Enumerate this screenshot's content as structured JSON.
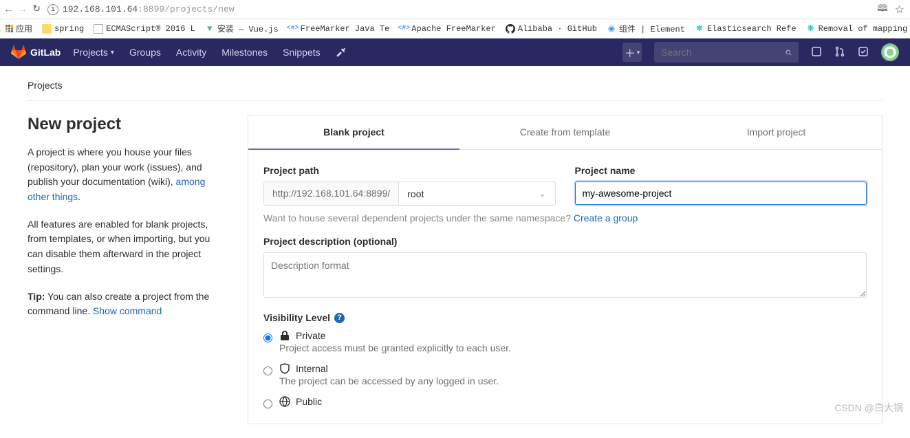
{
  "browser": {
    "url_host": "192.168.101.64",
    "url_port": ":8899",
    "url_path": "/projects/new",
    "translate_icon": "⇄",
    "star": "☆"
  },
  "bookmarks": {
    "apps": "应用",
    "items": [
      "spring",
      "ECMAScript® 2016 L",
      "安装 — Vue.js",
      "FreeMarker Java Te",
      "Apache FreeMarker",
      "Alibaba · GitHub",
      "组件 | Element",
      "Elasticsearch Refe",
      "Removal of mapping"
    ]
  },
  "header": {
    "brand": "GitLab",
    "nav": [
      "Projects",
      "Groups",
      "Activity",
      "Milestones",
      "Snippets"
    ],
    "search_placeholder": "Search"
  },
  "breadcrumb": "Projects",
  "sidebar": {
    "title": "New project",
    "p1a": "A project is where you house your files (repository), plan your work (issues), and publish your documentation (wiki), ",
    "p1_link": "among other things",
    "p1b": ".",
    "p2": "All features are enabled for blank projects, from templates, or when importing, but you can disable them afterward in the project settings.",
    "tip_label": "Tip:",
    "tip_text": " You can also create a project from the command line. ",
    "tip_link": "Show command"
  },
  "tabs": [
    "Blank project",
    "Create from template",
    "Import project"
  ],
  "form": {
    "path_label": "Project path",
    "path_prefix": "http://192.168.101.64:8899/",
    "namespace": "root",
    "name_label": "Project name",
    "name_value": "my-awesome-project",
    "hint_text": "Want to house several dependent projects under the same namespace? ",
    "hint_link": "Create a group",
    "desc_label": "Project description (optional)",
    "desc_placeholder": "Description format",
    "vis_label": "Visibility Level",
    "vis": [
      {
        "title": "Private",
        "desc": "Project access must be granted explicitly to each user."
      },
      {
        "title": "Internal",
        "desc": "The project can be accessed by any logged in user."
      },
      {
        "title": "Public",
        "desc": ""
      }
    ]
  },
  "watermark": "CSDN @白大锅"
}
